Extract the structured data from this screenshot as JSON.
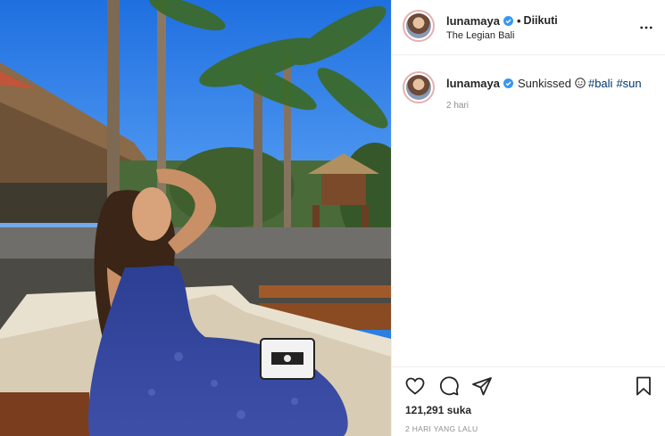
{
  "photo": {
    "description_icon": "beach-photo"
  },
  "header": {
    "username": "lunamaya",
    "dot": "•",
    "follow_state": "Diikuti",
    "location": "The Legian Bali",
    "verified_icon": "verified-badge-icon",
    "more_icon": "more-options-icon"
  },
  "caption": {
    "username": "lunamaya",
    "text": "Sunkissed",
    "emoji_icon": "smiling-face-icon",
    "hashtags": [
      "#bali",
      "#sun"
    ],
    "time_ago": "2 hari"
  },
  "actions": {
    "likes": "121,291 suka",
    "date": "2 HARI YANG LALU"
  },
  "colors": {
    "verified": "#3897f0",
    "hashtag": "#00376b",
    "muted": "#8e8e8e",
    "border": "#efefef"
  }
}
